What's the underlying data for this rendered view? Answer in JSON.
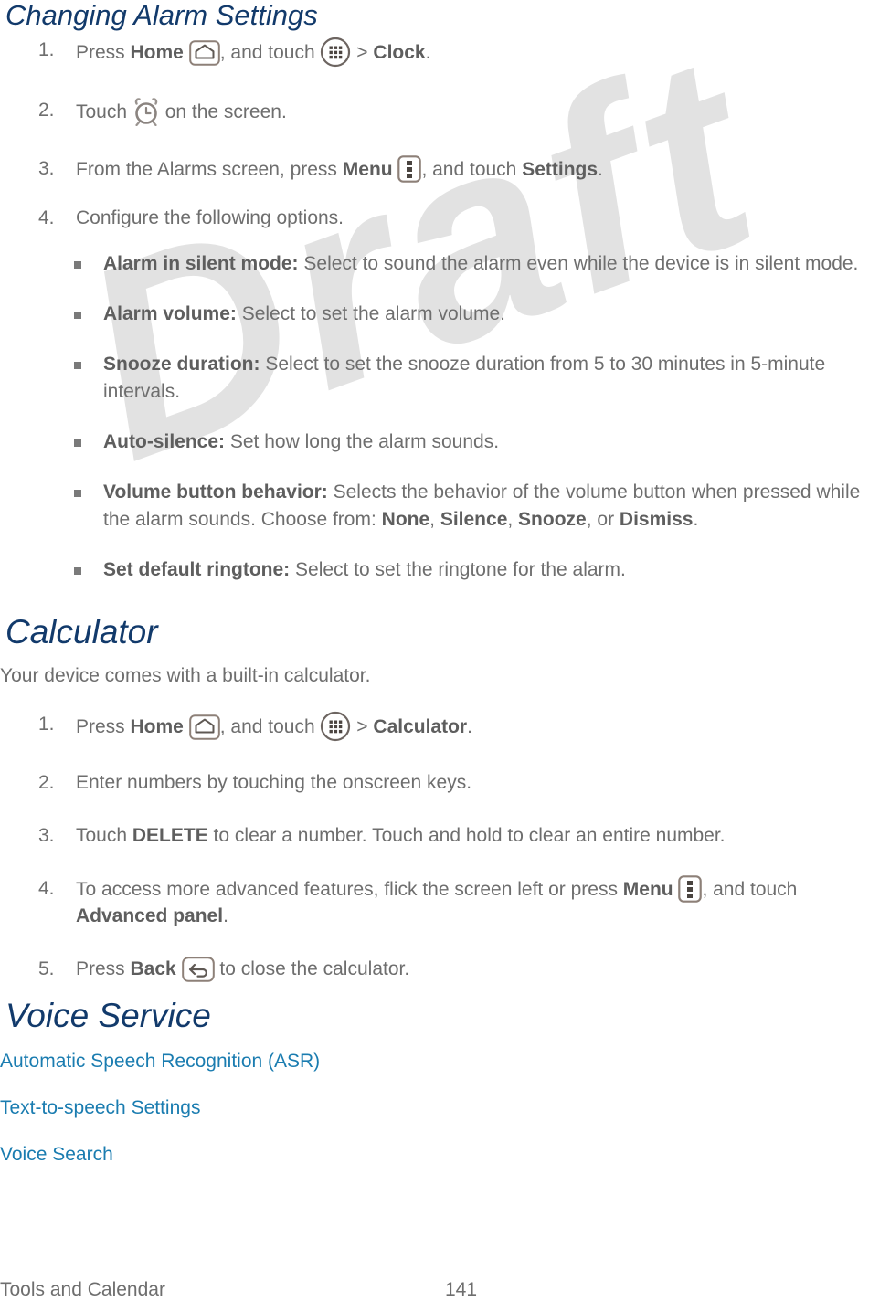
{
  "document": {
    "headings": {
      "alarm_settings": "Changing Alarm Settings",
      "calculator": "Calculator",
      "voice_service": "Voice Service"
    },
    "colors": {
      "heading": "#123a6b",
      "link": "#1a7cb0",
      "body": "#6e6e6e",
      "bold": "#5e5e5e",
      "watermark": "#e2e2e2"
    },
    "watermark": "Draft"
  },
  "alarm_steps": [
    {
      "num": "1.",
      "parts": [
        {
          "t": "text",
          "v": "Press "
        },
        {
          "t": "bold",
          "v": "Home"
        },
        {
          "t": "space",
          "v": " "
        },
        {
          "t": "icon",
          "v": "home-icon"
        },
        {
          "t": "text",
          "v": ", and touch "
        },
        {
          "t": "icon",
          "v": "apps-icon"
        },
        {
          "t": "text",
          "v": " > "
        },
        {
          "t": "bold",
          "v": "Clock"
        },
        {
          "t": "text",
          "v": "."
        }
      ]
    },
    {
      "num": "2.",
      "parts": [
        {
          "t": "text",
          "v": "Touch "
        },
        {
          "t": "icon",
          "v": "alarm-clock-icon"
        },
        {
          "t": "text",
          "v": " on the screen."
        }
      ]
    },
    {
      "num": "3.",
      "parts": [
        {
          "t": "text",
          "v": "From the Alarms screen, press "
        },
        {
          "t": "bold",
          "v": "Menu"
        },
        {
          "t": "space",
          "v": " "
        },
        {
          "t": "icon",
          "v": "menu-icon"
        },
        {
          "t": "text",
          "v": ", and touch "
        },
        {
          "t": "bold",
          "v": "Settings"
        },
        {
          "t": "text",
          "v": "."
        }
      ]
    },
    {
      "num": "4.",
      "parts": [
        {
          "t": "text",
          "v": "Configure the following options."
        }
      ]
    }
  ],
  "alarm_options": [
    {
      "term": "Alarm in silent mode:",
      "desc": " Select to sound the alarm even while the device is in silent mode."
    },
    {
      "term": "Alarm volume:",
      "desc": " Select to set the alarm volume."
    },
    {
      "term": "Snooze duration:",
      "desc": " Select to set the snooze duration from 5 to 30 minutes in 5-minute intervals."
    },
    {
      "term": "Auto-silence:",
      "desc": " Set how long the alarm sounds."
    },
    {
      "term": "Volume button behavior:",
      "desc_parts": [
        {
          "t": "text",
          "v": " Selects the behavior of the volume button when pressed while the alarm sounds. Choose from: "
        },
        {
          "t": "bold",
          "v": "None"
        },
        {
          "t": "text",
          "v": ", "
        },
        {
          "t": "bold",
          "v": "Silence"
        },
        {
          "t": "text",
          "v": ", "
        },
        {
          "t": "bold",
          "v": "Snooze"
        },
        {
          "t": "text",
          "v": ", or "
        },
        {
          "t": "bold",
          "v": "Dismiss"
        },
        {
          "t": "text",
          "v": "."
        }
      ]
    },
    {
      "term": "Set default ringtone:",
      "desc": " Select to set the ringtone for the alarm."
    }
  ],
  "calculator": {
    "intro": "Your device comes with a built-in calculator.",
    "steps": [
      {
        "num": "1.",
        "parts": [
          {
            "t": "text",
            "v": "Press "
          },
          {
            "t": "bold",
            "v": "Home"
          },
          {
            "t": "space",
            "v": " "
          },
          {
            "t": "icon",
            "v": "home-icon"
          },
          {
            "t": "text",
            "v": ", and touch "
          },
          {
            "t": "icon",
            "v": "apps-icon"
          },
          {
            "t": "text",
            "v": " > "
          },
          {
            "t": "bold",
            "v": "Calculator"
          },
          {
            "t": "text",
            "v": "."
          }
        ]
      },
      {
        "num": "2.",
        "parts": [
          {
            "t": "text",
            "v": "Enter numbers by touching the onscreen keys."
          }
        ]
      },
      {
        "num": "3.",
        "parts": [
          {
            "t": "text",
            "v": "Touch "
          },
          {
            "t": "bold",
            "v": "DELETE"
          },
          {
            "t": "text",
            "v": " to clear a number. Touch and hold to clear an entire number."
          }
        ]
      },
      {
        "num": "4.",
        "parts": [
          {
            "t": "text",
            "v": "To access more advanced features, flick the screen left or press "
          },
          {
            "t": "bold",
            "v": "Menu"
          },
          {
            "t": "space",
            "v": " "
          },
          {
            "t": "icon",
            "v": "menu-icon"
          },
          {
            "t": "text",
            "v": ", and touch "
          },
          {
            "t": "bold",
            "v": "Advanced panel"
          },
          {
            "t": "text",
            "v": "."
          }
        ]
      },
      {
        "num": "5.",
        "parts": [
          {
            "t": "text",
            "v": "Press "
          },
          {
            "t": "bold",
            "v": "Back"
          },
          {
            "t": "space",
            "v": " "
          },
          {
            "t": "icon",
            "v": "back-icon"
          },
          {
            "t": "text",
            "v": " to close the calculator."
          }
        ]
      }
    ]
  },
  "voice_service": {
    "links": [
      "Automatic Speech Recognition (ASR)",
      "Text-to-speech Settings",
      "Voice Search"
    ]
  },
  "footer": {
    "section": "Tools and Calendar",
    "page": "141"
  }
}
